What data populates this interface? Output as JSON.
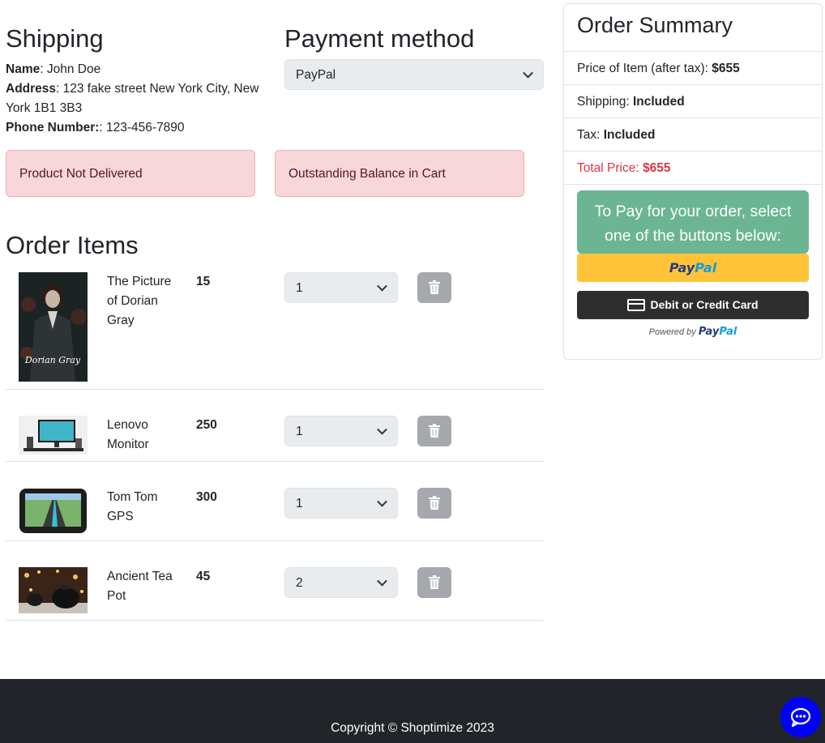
{
  "shipping": {
    "title": "Shipping",
    "name_label": "Name",
    "name_value": ": John Doe",
    "address_label": "Address",
    "address_value": ": 123 fake street New York City, New York 1B1 3B3",
    "phone_label": "Phone Number:",
    "phone_value": ": 123-456-7890"
  },
  "payment": {
    "title": "Payment method",
    "selected": "PayPal"
  },
  "alerts": {
    "delivery": "Product Not Delivered",
    "balance": "Outstanding Balance in Cart"
  },
  "order_items": {
    "title": "Order Items",
    "items": [
      {
        "name": "The Picture of Dorian Gray",
        "price": "15",
        "qty": "1",
        "image": "book-cover-dorian-gray"
      },
      {
        "name": "Lenovo Monitor",
        "price": "250",
        "qty": "1",
        "image": "desktop-monitor-photo"
      },
      {
        "name": "Tom Tom GPS",
        "price": "300",
        "qty": "1",
        "image": "gps-device-photo"
      },
      {
        "name": "Ancient Tea Pot",
        "price": "45",
        "qty": "2",
        "image": "tea-pot-photo"
      }
    ]
  },
  "summary": {
    "title": "Order Summary",
    "price_label": "Price of Item (after tax): ",
    "price_value": "$655",
    "shipping_label": "Shipping: ",
    "shipping_value": "Included",
    "tax_label": "Tax: ",
    "tax_value": "Included",
    "total_label": "Total Price: ",
    "total_value": "$655",
    "pay_note": "To Pay for your order, select one of the buttons below:",
    "paypal_pay": "Pay",
    "paypal_pal": "Pal",
    "card_button": "Debit or Credit Card",
    "powered_by": "Powered by ",
    "colors": {
      "note_bg": "#6bb593",
      "paypal_bg": "#ffc439",
      "danger": "#dc3545"
    }
  },
  "footer": {
    "copyright": "Copyright © Shoptimize 2023"
  },
  "icons": [
    "chevron-down-icon",
    "trash-icon",
    "card-icon",
    "chat-icon"
  ]
}
